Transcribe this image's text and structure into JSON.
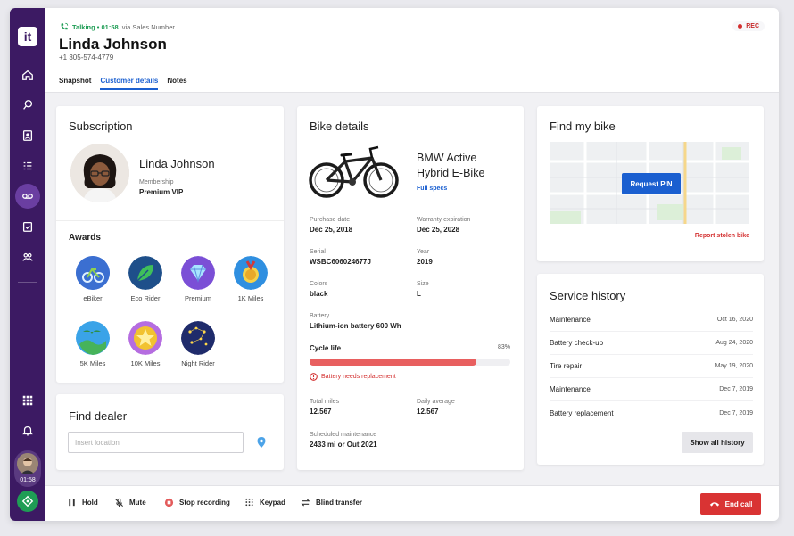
{
  "sidebar": {
    "logo": "it",
    "agent_call_time": "01:58"
  },
  "header": {
    "call_status": "Talking • 01:58",
    "call_via": "via Sales Number",
    "caller_name": "Linda Johnson",
    "caller_phone": "+1 305-574-4779",
    "rec_label": "REC",
    "tabs": [
      {
        "label": "Snapshot"
      },
      {
        "label": "Customer details"
      },
      {
        "label": "Notes"
      }
    ]
  },
  "subscription": {
    "title": "Subscription",
    "name": "Linda Johnson",
    "membership_label": "Membership",
    "membership_value": "Premium VIP",
    "awards_title": "Awards",
    "awards": [
      {
        "label": "eBiker"
      },
      {
        "label": "Eco Rider"
      },
      {
        "label": "Premium"
      },
      {
        "label": "1K Miles"
      },
      {
        "label": "5K Miles"
      },
      {
        "label": "10K Miles"
      },
      {
        "label": "Night Rider"
      }
    ]
  },
  "dealer": {
    "title": "Find dealer",
    "placeholder": "Insert location"
  },
  "bike": {
    "title": "Bike details",
    "model_line1": "BMW Active",
    "model_line2": "Hybrid E-Bike",
    "specs_link": "Full specs",
    "fields": {
      "purchase_label": "Purchase date",
      "purchase_value": "Dec 25, 2018",
      "warranty_label": "Warranty expiration",
      "warranty_value": "Dec 25, 2028",
      "serial_label": "Serial",
      "serial_value": "WSBC606024677J",
      "year_label": "Year",
      "year_value": "2019",
      "colors_label": "Colors",
      "colors_value": "black",
      "size_label": "Size",
      "size_value": "L",
      "battery_label": "Battery",
      "battery_value": "Lithium-ion battery 600 Wh"
    },
    "cycle_life_label": "Cycle life",
    "cycle_life_percent": "83%",
    "cycle_life_value": 0.83,
    "battery_warning": "Battery needs replacement",
    "total_miles_label": "Total miles",
    "total_miles_value": "12.567",
    "daily_avg_label": "Daily average",
    "daily_avg_value": "12.567",
    "maintenance_label": "Scheduled maintenance",
    "maintenance_value": "2433 mi or Out 2021"
  },
  "findbike": {
    "title": "Find my bike",
    "request_pin": "Request PIN",
    "report_stolen": "Report stolen bike"
  },
  "service": {
    "title": "Service history",
    "rows": [
      {
        "name": "Maintenance",
        "date": "Oct 16, 2020"
      },
      {
        "name": "Battery check-up",
        "date": "Aug 24, 2020"
      },
      {
        "name": "Tire repair",
        "date": "May 19, 2020"
      },
      {
        "name": "Maintenance",
        "date": "Dec 7, 2019"
      },
      {
        "name": "Battery replacement",
        "date": "Dec 7, 2019"
      }
    ],
    "show_all": "Show all history"
  },
  "callbar": {
    "hold": "Hold",
    "mute": "Mute",
    "stop_recording": "Stop recording",
    "keypad": "Keypad",
    "blind_transfer": "Blind transfer",
    "end_call": "End call"
  },
  "colors": {
    "sidebar": "#3c1a63",
    "accent": "#1a5fd0",
    "talking": "#1f9d55",
    "danger": "#d93333"
  }
}
